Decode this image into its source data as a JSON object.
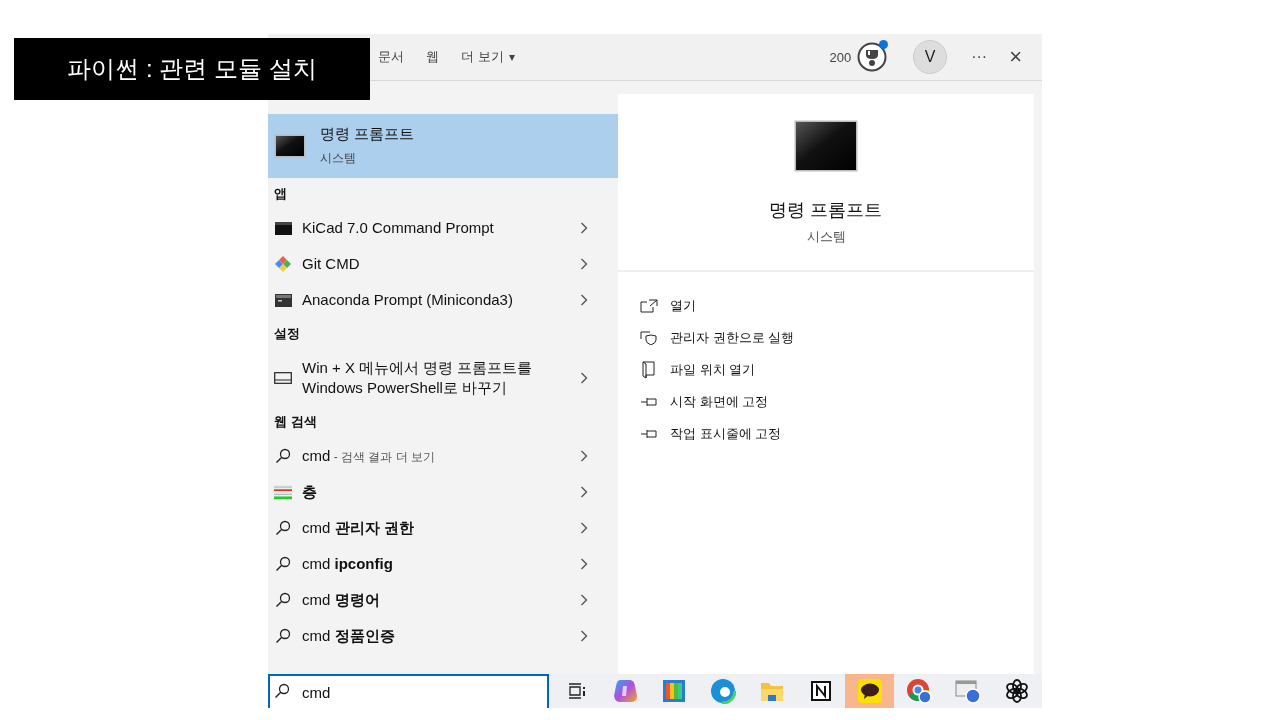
{
  "slide_title": "파이썬 : 관련 모듈 설치",
  "tabs": [
    {
      "label": "문서",
      "selected": false,
      "kind": "plain"
    },
    {
      "label": "웹",
      "selected": false,
      "kind": "plain"
    },
    {
      "label": "더 보기",
      "selected": false,
      "kind": "dropdown",
      "caret": "▾"
    }
  ],
  "points": "200",
  "avatar": "V",
  "more": "···",
  "close": "×",
  "best_match": {
    "title": "명령 프롬프트",
    "subtitle": "시스템",
    "selected": true
  },
  "sections": [
    {
      "heading": "앱",
      "items": [
        {
          "kind": "kicad",
          "text": "KiCad 7.0 Command Prompt"
        },
        {
          "kind": "git",
          "text": "Git CMD"
        },
        {
          "kind": "anaconda",
          "text": "Anaconda Prompt (Miniconda3)"
        }
      ]
    },
    {
      "heading": "설정",
      "items": [
        {
          "kind": "setting",
          "text": "Win + X 메뉴에서 명령 프롬프트를 Windows PowerShell로 바꾸기"
        }
      ]
    },
    {
      "heading": "웹 검색",
      "items": [
        {
          "kind": "search",
          "text": "cmd",
          "hint": "- 검색 결과 더 보기"
        },
        {
          "kind": "image",
          "text": "**층**"
        },
        {
          "kind": "search",
          "text": "cmd **관리자 권한**"
        },
        {
          "kind": "search",
          "text": "cmd **ipconfig**"
        },
        {
          "kind": "search",
          "text": "cmd **명령어**"
        },
        {
          "kind": "search",
          "text": "cmd **정품인증**"
        }
      ]
    }
  ],
  "preview": {
    "title": "명령 프롬프트",
    "subtitle": "시스템",
    "actions": [
      {
        "kind": "open",
        "label": "열기"
      },
      {
        "kind": "admin",
        "label": "관리자 권한으로 실행"
      },
      {
        "kind": "folder",
        "label": "파일 위치 열기"
      },
      {
        "kind": "pin",
        "label": "시작 화면에 고정"
      },
      {
        "kind": "pin",
        "label": "작업 표시줄에 고정"
      }
    ]
  },
  "search": {
    "value": "cmd"
  },
  "taskbar": [
    {
      "kind": "taskview",
      "active": false
    },
    {
      "kind": "copilot",
      "active": false
    },
    {
      "kind": "colorbars",
      "active": false
    },
    {
      "kind": "edge",
      "active": false
    },
    {
      "kind": "folder",
      "active": false
    },
    {
      "kind": "notes",
      "active": false
    },
    {
      "kind": "chat",
      "active": true
    },
    {
      "kind": "chrome",
      "active": false
    },
    {
      "kind": "remote",
      "active": false
    },
    {
      "kind": "knot",
      "active": false
    }
  ]
}
